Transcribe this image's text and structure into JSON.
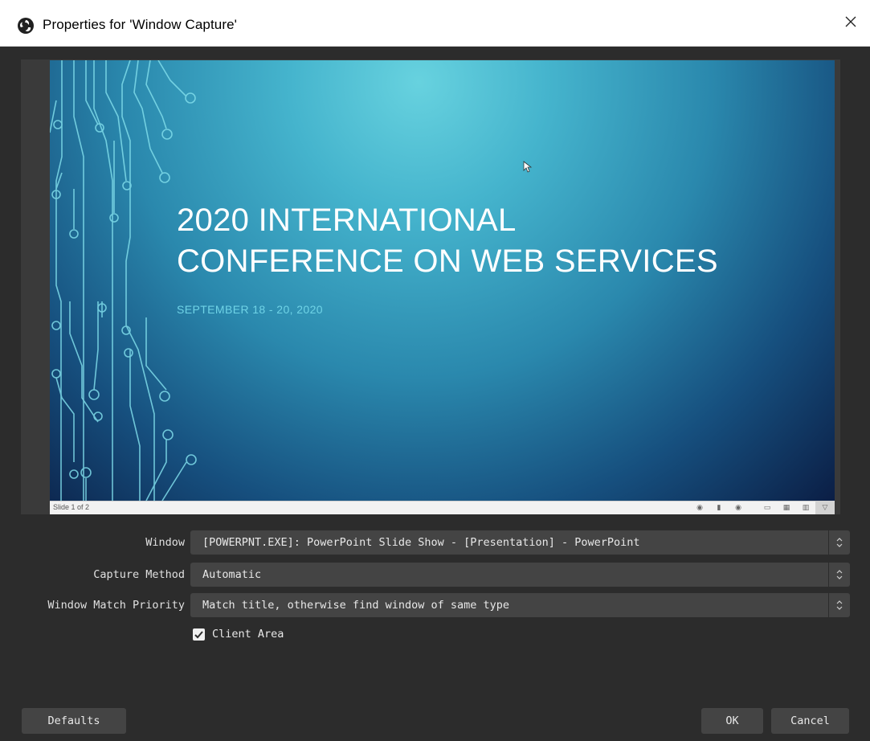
{
  "window": {
    "title": "Properties for 'Window Capture'"
  },
  "preview": {
    "slide_title_line1": "2020 INTERNATIONAL",
    "slide_title_line2": "CONFERENCE ON WEB SERVICES",
    "slide_subtitle": "SEPTEMBER 18 - 20, 2020",
    "slide_count": "Slide 1 of 2"
  },
  "form": {
    "window_label": "Window",
    "window_value": "[POWERPNT.EXE]: PowerPoint Slide Show - [Presentation] - PowerPoint",
    "capture_method_label": "Capture Method",
    "capture_method_value": "Automatic",
    "match_priority_label": "Window Match Priority",
    "match_priority_value": "Match title, otherwise find window of same type",
    "client_area_label": "Client Area",
    "client_area_checked": true
  },
  "buttons": {
    "defaults": "Defaults",
    "ok": "OK",
    "cancel": "Cancel"
  },
  "colors": {
    "accent_cyan": "#6fd3e6",
    "dialog_bg": "#2c2c2c",
    "control_bg": "#444444"
  }
}
